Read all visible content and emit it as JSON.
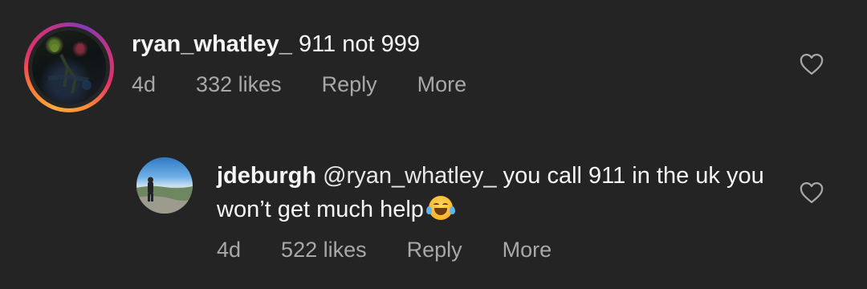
{
  "comments": [
    {
      "username": "ryan_whatley_",
      "text": "911 not 999",
      "age": "4d",
      "likes": "332 likes",
      "reply_label": "Reply",
      "more_label": "More",
      "like_icon": "heart-outline-icon",
      "has_story_ring": true
    },
    {
      "username": "jdeburgh",
      "mention": "@ryan_whatley_",
      "text": "you call 911 in the uk you won’t get much help",
      "emoji": "😂",
      "emoji_name": "face-with-tears-of-joy",
      "age": "4d",
      "likes": "522 likes",
      "reply_label": "Reply",
      "more_label": "More",
      "like_icon": "heart-outline-icon",
      "has_story_ring": false
    }
  ],
  "colors": {
    "background": "#242424",
    "primary_text": "#f5f5f5",
    "secondary_text": "#a8a8a8",
    "story_ring": [
      "#fbaa3c",
      "#e1306c",
      "#833ab4"
    ]
  }
}
